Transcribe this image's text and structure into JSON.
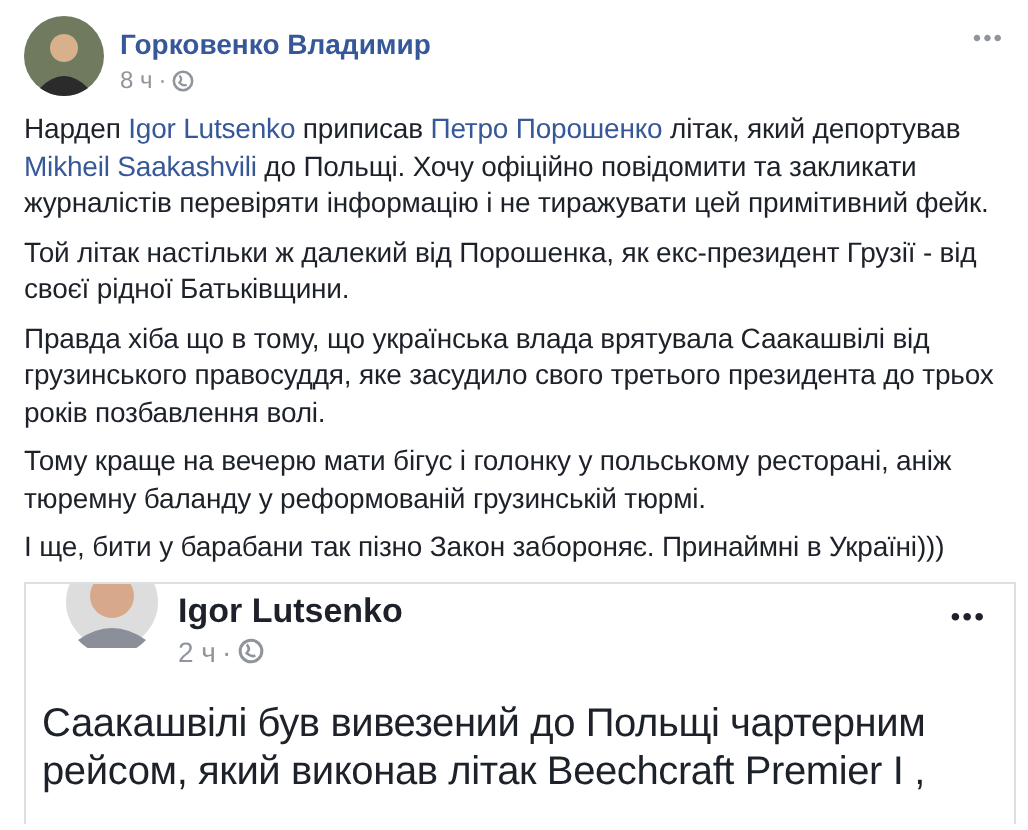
{
  "post": {
    "author": "Горковенко Владимир",
    "time": "8 ч",
    "separator": "·",
    "menu": "•••",
    "paragraphs": [
      [
        {
          "kind": "text",
          "text": "Нардеп "
        },
        {
          "kind": "link",
          "text": "Igor Lutsenko"
        },
        {
          "kind": "text",
          "text": " приписав "
        },
        {
          "kind": "link",
          "text": "Петро Порошенко"
        },
        {
          "kind": "text",
          "text": " літак, який депортував "
        },
        {
          "kind": "link",
          "text": "Mikheil Saakashvili"
        },
        {
          "kind": "text",
          "text": " до Польщі. Хочу офіційно повідомити та закликати журналістів перевіряти інформацію і не тиражувати цей примітивний фейк."
        }
      ],
      [
        {
          "kind": "text",
          "text": "Той літак настільки ж далекий від Порошенка, як екс-президент Грузії - від своєї рідної Батьківщини."
        }
      ],
      [
        {
          "kind": "text",
          "text": "Правда хіба що в тому, що українська влада врятувала Саакашвілі від грузинського правосуддя, яке засудило свого третього президента до трьох років позбавлення волі."
        }
      ],
      [
        {
          "kind": "text",
          "text": "Тому краще на вечерю мати бігус і голонку у польському ресторані, аніж тюремну баланду у реформованій грузинській тюрмі."
        }
      ],
      [
        {
          "kind": "text",
          "text": "І ще, бити у барабани так пізно Закон забороняє. Принаймні в Україні)))"
        }
      ]
    ],
    "shared": {
      "author": "Igor Lutsenko",
      "time": "2 ч",
      "separator": "·",
      "menu": "•••",
      "text": "Саакашвілі був вивезений до Польщі чартерним рейсом, який виконав літак Beechcraft Premier I ,"
    }
  }
}
